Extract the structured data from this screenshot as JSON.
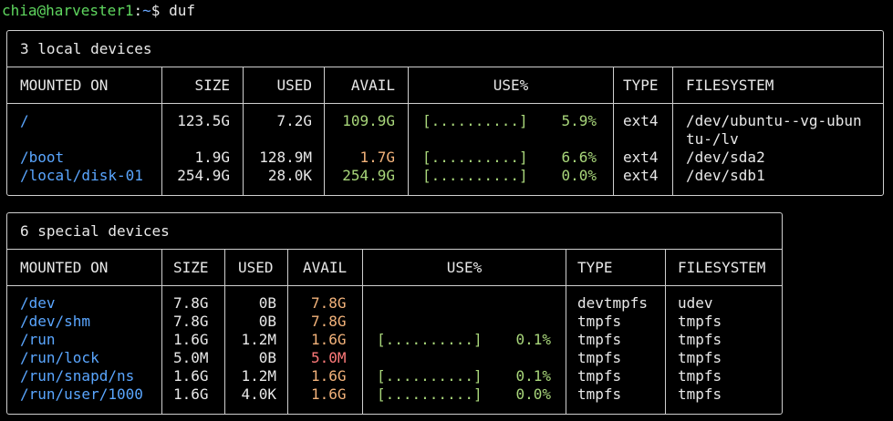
{
  "prompt": {
    "user_host": "chia@harvester1",
    "separator": ":",
    "path": "~",
    "symbol": "$",
    "command": "duf"
  },
  "local": {
    "title": "3 local devices",
    "headers": {
      "mounted": "MOUNTED ON",
      "size": "SIZE",
      "used": "USED",
      "avail": "AVAIL",
      "use": "USE%",
      "type": "TYPE",
      "fs": "FILESYSTEM"
    },
    "rows": [
      {
        "mount": "/",
        "size": "123.5G",
        "used": "7.2G",
        "avail": "109.9G",
        "bar": "[..........]",
        "pct": "5.9%",
        "type": "ext4",
        "fs": "/dev/ubuntu--vg-ubun",
        "fs2": "tu-/lv"
      },
      {
        "mount": "/boot",
        "size": "1.9G",
        "used": "128.9M",
        "avail": "1.7G",
        "bar": "[..........]",
        "pct": "6.6%",
        "type": "ext4",
        "fs": "/dev/sda2"
      },
      {
        "mount": "/local/disk-01",
        "size": "254.9G",
        "used": "28.0K",
        "avail": "254.9G",
        "bar": "[..........]",
        "pct": "0.0%",
        "type": "ext4",
        "fs": "/dev/sdb1"
      }
    ]
  },
  "special": {
    "title": "6 special devices",
    "headers": {
      "mounted": "MOUNTED ON",
      "size": "SIZE",
      "used": "USED",
      "avail": "AVAIL",
      "use": "USE%",
      "type": "TYPE",
      "fs": "FILESYSTEM"
    },
    "rows": [
      {
        "mount": "/dev",
        "size": "7.8G",
        "used": "0B",
        "avail": "7.8G",
        "bar": "",
        "pct": "",
        "type": "devtmpfs",
        "fs": "udev"
      },
      {
        "mount": "/dev/shm",
        "size": "7.8G",
        "used": "0B",
        "avail": "7.8G",
        "bar": "",
        "pct": "",
        "type": "tmpfs",
        "fs": "tmpfs"
      },
      {
        "mount": "/run",
        "size": "1.6G",
        "used": "1.2M",
        "avail": "1.6G",
        "bar": "[..........]",
        "pct": "0.1%",
        "type": "tmpfs",
        "fs": "tmpfs"
      },
      {
        "mount": "/run/lock",
        "size": "5.0M",
        "used": "0B",
        "avail": "5.0M",
        "bar": "",
        "pct": "",
        "type": "tmpfs",
        "fs": "tmpfs"
      },
      {
        "mount": "/run/snapd/ns",
        "size": "1.6G",
        "used": "1.2M",
        "avail": "1.6G",
        "bar": "[..........]",
        "pct": "0.1%",
        "type": "tmpfs",
        "fs": "tmpfs"
      },
      {
        "mount": "/run/user/1000",
        "size": "1.6G",
        "used": "4.0K",
        "avail": "1.6G",
        "bar": "[..........]",
        "pct": "0.0%",
        "type": "tmpfs",
        "fs": "tmpfs"
      }
    ]
  },
  "colors": {
    "mount": "#5aa6ff",
    "avail_green": "#a8d67a",
    "avail_orange": "#f2b27a",
    "avail_red": "#ff7a7a",
    "bar_green": "#a8d67a",
    "border": "#cfcfcf"
  }
}
